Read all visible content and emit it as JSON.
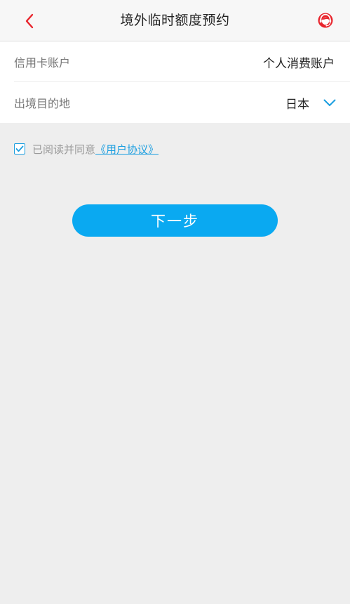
{
  "header": {
    "title": "境外临时额度预约",
    "back_icon": "chevron-left-icon",
    "service_icon": "customer-service-icon",
    "accent_color": "#e8232b"
  },
  "form": {
    "account": {
      "label": "信用卡账户",
      "value": "个人消费账户"
    },
    "destination": {
      "label": "出境目的地",
      "value": "日本",
      "dropdown_icon": "chevron-down-icon"
    }
  },
  "agreement": {
    "checked": true,
    "text": "已阅读并同意",
    "link_text": "《用户协议》",
    "link_color": "#1a9ee0"
  },
  "actions": {
    "next_label": "下一步",
    "button_color": "#0aa9f1"
  }
}
